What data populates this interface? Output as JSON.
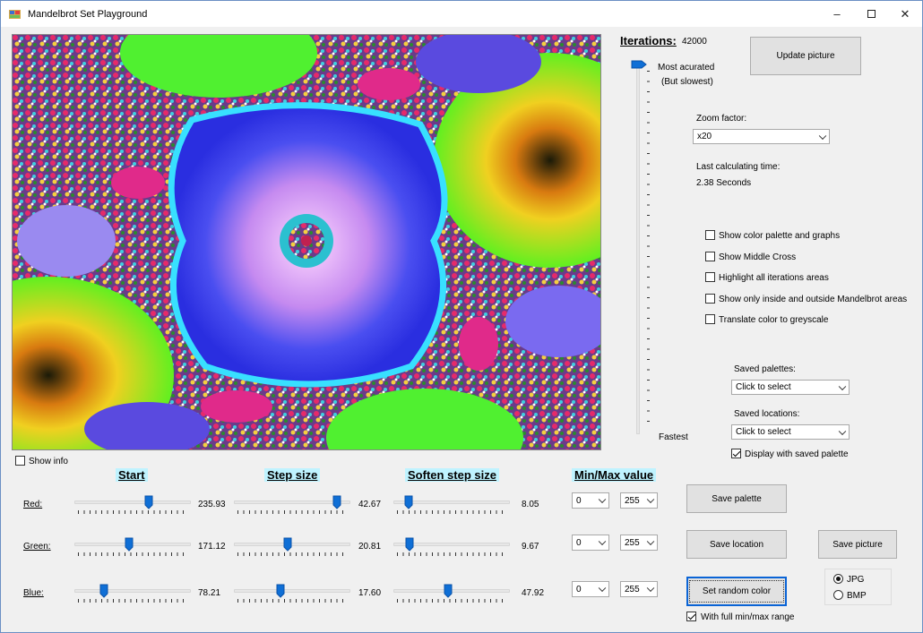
{
  "window": {
    "title": "Mandelbrot Set Playground"
  },
  "iterations": {
    "label": "Iterations:",
    "value": "42000",
    "top_label": "Most acurated",
    "top_sublabel": "(But slowest)",
    "bottom_label": "Fastest",
    "level": 1.0
  },
  "update_button": "Update picture",
  "zoom": {
    "label": "Zoom factor:",
    "value": "x20"
  },
  "calc": {
    "label": "Last calculating time:",
    "value": "2.38 Seconds"
  },
  "options": [
    {
      "label": "Show color palette and graphs",
      "checked": false
    },
    {
      "label": "Show Middle Cross",
      "checked": false
    },
    {
      "label": "Highlight all iterations areas",
      "checked": false
    },
    {
      "label": "Show only inside and outside Mandelbrot areas",
      "checked": false
    },
    {
      "label": "Translate color to greyscale",
      "checked": false
    }
  ],
  "saved_palettes": {
    "label": "Saved palettes:",
    "value": "Click to select"
  },
  "saved_locations": {
    "label": "Saved locations:",
    "value": "Click to select"
  },
  "display_saved_palette": {
    "label": "Display with saved palette",
    "checked": true
  },
  "show_info": {
    "label": "Show info",
    "checked": false
  },
  "headers": {
    "start": "Start",
    "step": "Step size",
    "soften": "Soften step size",
    "minmax": "Min/Max value"
  },
  "channels": [
    {
      "name": "Red:",
      "start": "235.93",
      "start_pos": 0.65,
      "step": "42.67",
      "step_pos": 0.92,
      "soften": "8.05",
      "soften_pos": 0.1,
      "min": "0",
      "max": "255"
    },
    {
      "name": "Green:",
      "start": "171.12",
      "start_pos": 0.47,
      "step": "20.81",
      "step_pos": 0.46,
      "soften": "9.67",
      "soften_pos": 0.11,
      "min": "0",
      "max": "255"
    },
    {
      "name": "Blue:",
      "start": "78.21",
      "start_pos": 0.23,
      "step": "17.60",
      "step_pos": 0.39,
      "soften": "47.92",
      "soften_pos": 0.47,
      "min": "0",
      "max": "255"
    }
  ],
  "buttons": {
    "save_palette": "Save  palette",
    "save_location": "Save location",
    "save_picture": "Save picture",
    "random_color": "Set random color"
  },
  "full_range": {
    "label": "With full min/max range",
    "checked": true
  },
  "format": {
    "jpg": "JPG",
    "bmp": "BMP",
    "selected": "JPG"
  }
}
